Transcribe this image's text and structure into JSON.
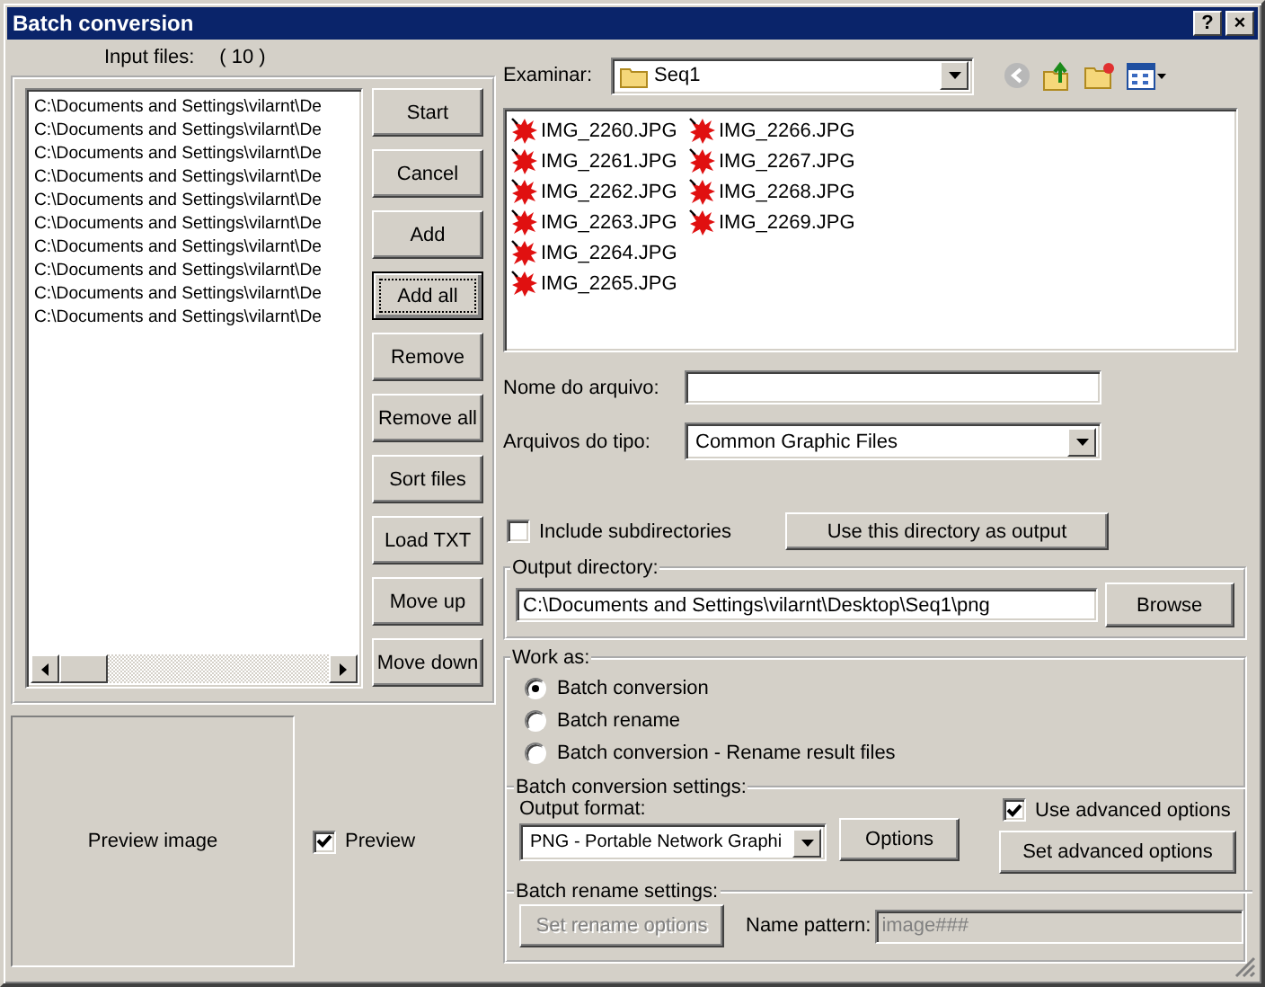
{
  "window": {
    "title": "Batch conversion",
    "buttons": [
      "?",
      "×"
    ]
  },
  "input_files": {
    "label": "Input files:",
    "count": "( 10 )",
    "items": [
      "C:\\Documents and Settings\\vilarnt\\De",
      "C:\\Documents and Settings\\vilarnt\\De",
      "C:\\Documents and Settings\\vilarnt\\De",
      "C:\\Documents and Settings\\vilarnt\\De",
      "C:\\Documents and Settings\\vilarnt\\De",
      "C:\\Documents and Settings\\vilarnt\\De",
      "C:\\Documents and Settings\\vilarnt\\De",
      "C:\\Documents and Settings\\vilarnt\\De",
      "C:\\Documents and Settings\\vilarnt\\De",
      "C:\\Documents and Settings\\vilarnt\\De"
    ]
  },
  "list_buttons": [
    {
      "label": "Start",
      "focused": false
    },
    {
      "label": "Cancel",
      "focused": false
    },
    {
      "label": "Add",
      "focused": false
    },
    {
      "label": "Add all",
      "focused": true
    },
    {
      "label": "Remove",
      "focused": false
    },
    {
      "label": "Remove all",
      "focused": false
    },
    {
      "label": "Sort files",
      "focused": false
    },
    {
      "label": "Load TXT",
      "focused": false
    },
    {
      "label": "Move up",
      "focused": false
    },
    {
      "label": "Move down",
      "focused": false
    }
  ],
  "preview": {
    "text": "Preview image",
    "checkbox": {
      "label": "Preview",
      "checked": true
    }
  },
  "browser": {
    "look_in_label": "Examinar:",
    "folder": "Seq1",
    "files": [
      "IMG_2260.JPG",
      "IMG_2261.JPG",
      "IMG_2262.JPG",
      "IMG_2263.JPG",
      "IMG_2264.JPG",
      "IMG_2265.JPG",
      "IMG_2266.JPG",
      "IMG_2267.JPG",
      "IMG_2268.JPG",
      "IMG_2269.JPG"
    ],
    "file_name_label": "Nome do arquivo:",
    "file_type_label": "Arquivos do tipo:",
    "file_type": "Common Graphic Files"
  },
  "include_subdirectories": {
    "label": "Include subdirectories",
    "checked": false
  },
  "use_directory_button": "Use this directory as output",
  "output_directory": {
    "legend": "Output directory:",
    "value": "C:\\Documents and Settings\\vilarnt\\Desktop\\Seq1\\png",
    "button": "Browse"
  },
  "work_as": {
    "legend": "Work as:",
    "options": [
      {
        "label": "Batch conversion",
        "selected": true
      },
      {
        "label": "Batch rename",
        "selected": false
      },
      {
        "label": "Batch conversion - Rename result files",
        "selected": false
      }
    ]
  },
  "conversion_settings": {
    "legend": "Batch conversion settings:",
    "format_label": "Output format:",
    "format": "PNG - Portable Network Graphi",
    "options_button": "Options",
    "advanced": {
      "label": "Use advanced options",
      "checked": true
    },
    "advanced_button": "Set advanced options"
  },
  "rename_settings": {
    "legend": "Batch rename settings:",
    "button": {
      "label": "Set rename options",
      "disabled": true
    },
    "pattern_label": "Name pattern:",
    "pattern": {
      "value": "image###",
      "disabled": true
    }
  }
}
